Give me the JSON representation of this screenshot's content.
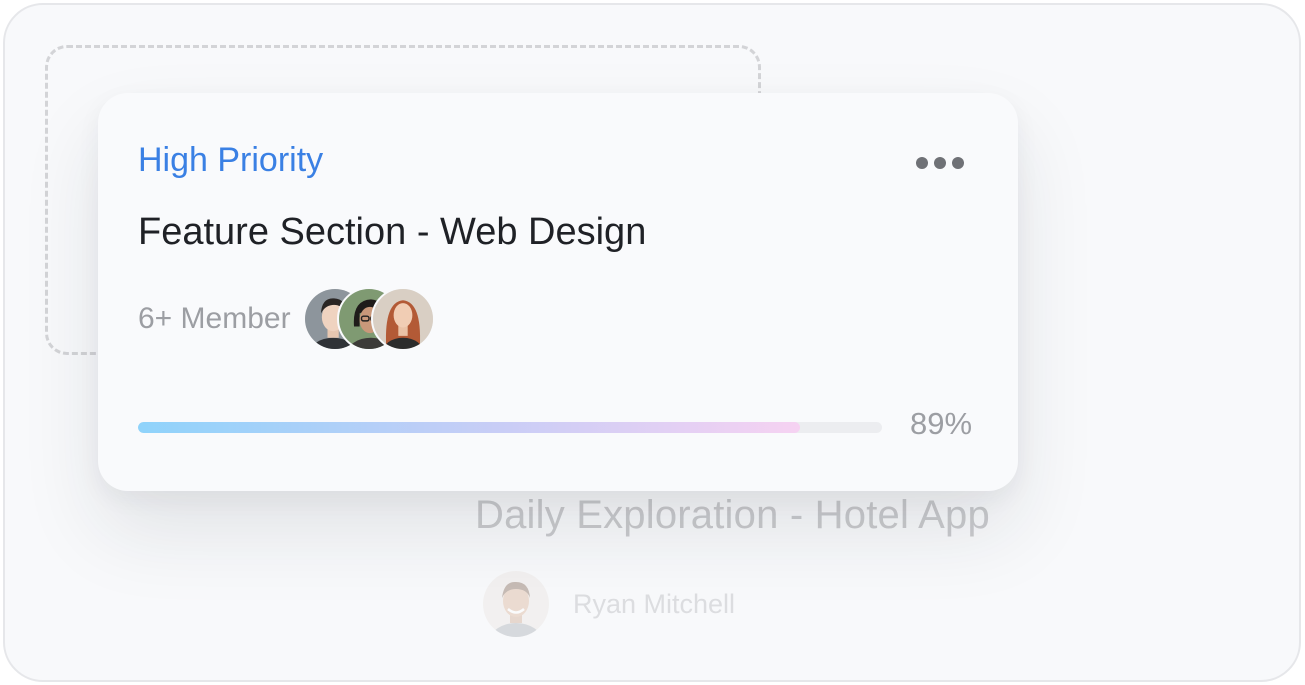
{
  "background_card": {
    "title": "Daily Exploration - Hotel App",
    "assignee": {
      "name": "Ryan Mitchell",
      "avatar": "man-smiling-avatar"
    }
  },
  "task_card": {
    "priority_label": "High Priority",
    "title": "Feature Section - Web Design",
    "members_label": "6+ Member",
    "avatars": [
      "man-portrait-avatar",
      "woman-glasses-avatar",
      "woman-red-hair-avatar"
    ],
    "progress_value": 0.89,
    "progress_label": "89%",
    "more_icon": "more-horizontal-icon"
  },
  "colors": {
    "priority": "#3a80e4",
    "progress_start": "#8fd3fb",
    "progress_end": "#f6d2f2"
  }
}
